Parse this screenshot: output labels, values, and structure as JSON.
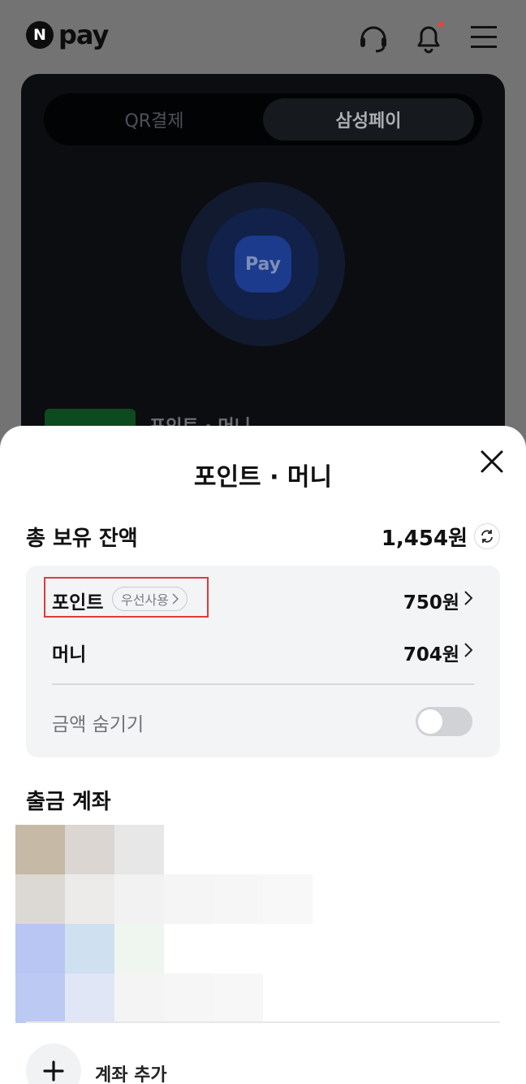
{
  "app": {
    "logo_mark": "N",
    "logo_text": "pay"
  },
  "payment_tabs": [
    {
      "label": "QR결제",
      "selected": false
    },
    {
      "label": "삼성페이",
      "selected": true
    }
  ],
  "pay_button_label": "Pay",
  "peek_label": "포인트 · 머니",
  "sheet": {
    "title": "포인트 · 머니",
    "total_label": "총 보유 잔액",
    "total_amount": "1,454원",
    "rows": {
      "point": {
        "label": "포인트",
        "chip": "우선사용",
        "amount": "750원"
      },
      "money": {
        "label": "머니",
        "amount": "704원"
      }
    },
    "hide_label": "금액 숨기기",
    "hide_toggle_on": false,
    "account_title": "출금 계좌",
    "add_account_label": "계좌 추가"
  },
  "colors": {
    "highlight": "#e03a3c",
    "notification_dot": "#e8443a",
    "sheet_bg": "#ffffff",
    "balance_box_bg": "#f3f4f6"
  }
}
